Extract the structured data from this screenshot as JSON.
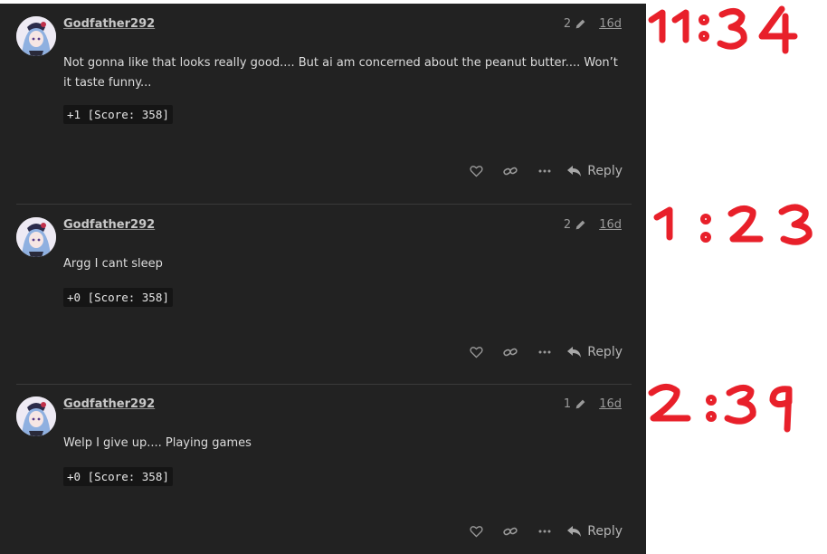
{
  "posts": [
    {
      "username": "Godfather292",
      "edit_count": "2",
      "age": "16d",
      "body": "Not gonna like that looks really good.... But ai am concerned about the peanut butter.... Won’t it taste funny...",
      "score": "+1 [Score: 358]",
      "reply_label": "Reply",
      "annotation": "11:34"
    },
    {
      "username": "Godfather292",
      "edit_count": "2",
      "age": "16d",
      "body": "Argg I cant sleep",
      "score": "+0 [Score: 358]",
      "reply_label": "Reply",
      "annotation": "1:23"
    },
    {
      "username": "Godfather292",
      "edit_count": "1",
      "age": "16d",
      "body": "Welp I give up.... Playing games",
      "score": "+0 [Score: 358]",
      "reply_label": "Reply",
      "annotation": "2:39"
    }
  ],
  "icons": {
    "like": "heart-icon",
    "link": "link-icon",
    "more": "ellipsis-icon",
    "reply": "reply-arrow-icon",
    "edit": "pencil-icon"
  },
  "colors": {
    "panel_bg": "#222222",
    "annotation_red": "#e8202a"
  }
}
